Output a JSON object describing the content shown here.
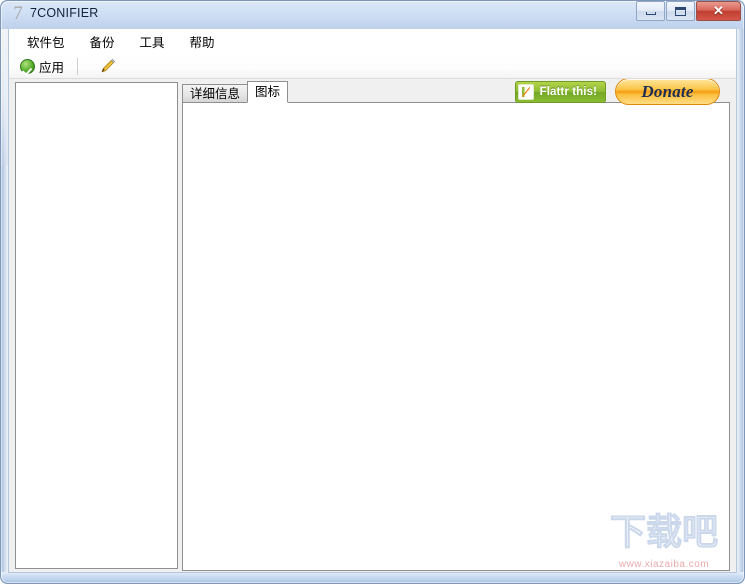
{
  "window": {
    "title": "7CONIFIER",
    "icon": "app-7-icon",
    "caption_buttons": [
      {
        "name": "minimize",
        "glyph": "minimize-icon",
        "label": ""
      },
      {
        "name": "maximize",
        "glyph": "maximize-icon",
        "label": ""
      },
      {
        "name": "close",
        "glyph": "close-icon",
        "label": "✕"
      }
    ]
  },
  "menu": {
    "items": [
      {
        "label": "软件包"
      },
      {
        "label": "备份"
      },
      {
        "label": "工具"
      },
      {
        "label": "帮助"
      }
    ]
  },
  "toolbar": {
    "apply_label": "应用",
    "apply_icon": "green-check-icon",
    "edit_icon": "pencil-icon"
  },
  "tabs": {
    "items": [
      {
        "label": "详细信息",
        "active": false
      },
      {
        "label": "图标",
        "active": true
      }
    ]
  },
  "panels": {
    "left_list_items": [],
    "tab_content": ""
  },
  "promo": {
    "flattr_label": "Flattr this!",
    "flattr_icon": "flattr-logo-icon",
    "donate_label": "Donate"
  },
  "watermark": {
    "logo_text": "下载吧",
    "url_text": "www.xiazaiba.com"
  },
  "colors": {
    "titlebar": "#c4d6ef",
    "close_button": "#c03f32",
    "apply_green": "#55ad2c",
    "flattr_green": "#8cbd33",
    "donate_orange": "#f59d15",
    "client_bg": "#f0f0f0",
    "panel_bg": "#ffffff"
  }
}
